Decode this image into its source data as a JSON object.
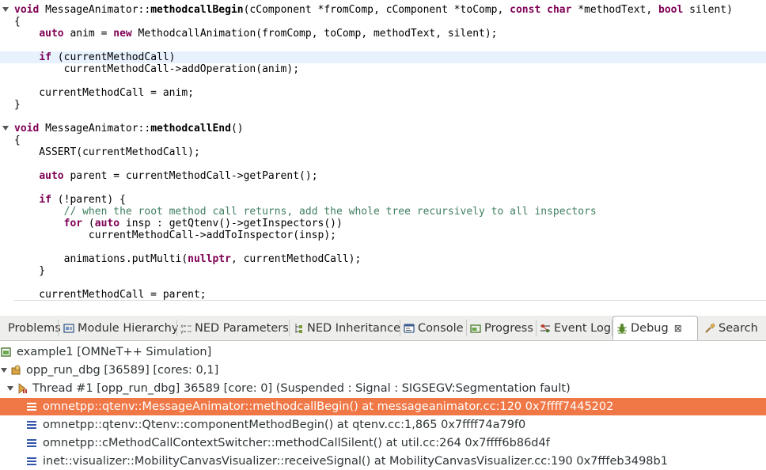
{
  "editor": {
    "lines": [
      "void MessageAnimator::methodcallBegin(cComponent *fromComp, cComponent *toComp, const char *methodText, bool silent)",
      "{",
      "    auto anim = new MethodcallAnimation(fromComp, toComp, methodText, silent);",
      "",
      "    if (currentMethodCall)",
      "        currentMethodCall->addOperation(anim);",
      "",
      "    currentMethodCall = anim;",
      "}",
      "",
      "void MessageAnimator::methodcallEnd()",
      "{",
      "    ASSERT(currentMethodCall);",
      "",
      "    auto parent = currentMethodCall->getParent();",
      "",
      "    if (!parent) {",
      "        // when the root method call returns, add the whole tree recursively to all inspectors",
      "        for (auto insp : getQtenv()->getInspectors())",
      "            currentMethodCall->addToInspector(insp);",
      "",
      "        animations.putMulti(nullptr, currentMethodCall);",
      "    }",
      "",
      "    currentMethodCall = parent;"
    ],
    "current_line_index": 4
  },
  "tabs": [
    {
      "label": "Problems",
      "icon": "problems-icon"
    },
    {
      "label": "Module Hierarchy",
      "icon": "module-hierarchy-icon"
    },
    {
      "label": "NED Parameters",
      "icon": "ned-parameters-icon"
    },
    {
      "label": "NED Inheritance",
      "icon": "ned-inheritance-icon"
    },
    {
      "label": "Console",
      "icon": "console-icon"
    },
    {
      "label": "Progress",
      "icon": "progress-icon"
    },
    {
      "label": "Event Log",
      "icon": "event-log-icon"
    },
    {
      "label": "Debug",
      "icon": "debug-icon",
      "active": true,
      "close": "⊠"
    },
    {
      "label": "Search",
      "icon": "search-icon"
    }
  ],
  "debug": {
    "launch": "example1 [OMNeT++ Simulation]",
    "process": "opp_run_dbg [36589] [cores: 0,1]",
    "thread": "Thread #1 [opp_run_dbg] 36589 [core: 0] (Suspended : Signal : SIGSEGV:Segmentation fault)",
    "frames": [
      "omnetpp::qtenv::MessageAnimator::methodcallBegin() at messageanimator.cc:120 0x7ffff7445202",
      "omnetpp::qtenv::Qtenv::componentMethodBegin() at qtenv.cc:1,865 0x7ffff74a79f0",
      "omnetpp::cMethodCallContextSwitcher::methodCallSilent() at util.cc:264 0x7ffff6b86d4f",
      "inet::visualizer::MobilityCanvasVisualizer::receiveSignal() at MobilityCanvasVisualizer.cc:190 0x7fffeb3498b1"
    ],
    "selected_frame": 0
  },
  "colors": {
    "keyword": "#7f0055",
    "comment": "#3f7f5f",
    "selection": "#f07746",
    "current_line": "#e8f2fe"
  }
}
